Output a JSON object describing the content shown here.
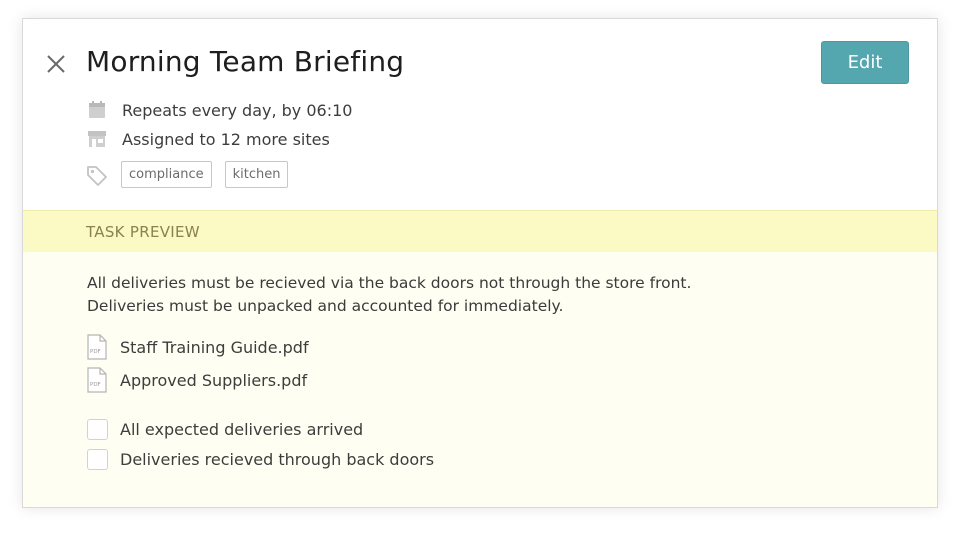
{
  "header": {
    "title": "Morning Team Briefing",
    "edit_label": "Edit",
    "close_icon": "close-icon"
  },
  "meta": {
    "schedule": "Repeats every day, by 06:10",
    "schedule_icon": "calendar-icon",
    "assignment": "Assigned to 12 more sites",
    "assignment_icon": "store-icon",
    "tags_icon": "tag-icon",
    "tags": [
      "compliance",
      "kitchen"
    ]
  },
  "preview": {
    "label": "TASK PREVIEW",
    "description_lines": [
      "All deliveries must be recieved via the back doors not through the store front.",
      "Deliveries must be unpacked and accounted for immediately."
    ],
    "files": [
      {
        "name": "Staff Training Guide.pdf",
        "icon": "pdf-file-icon"
      },
      {
        "name": "Approved Suppliers.pdf",
        "icon": "pdf-file-icon"
      }
    ],
    "checklist": [
      {
        "label": "All expected deliveries arrived",
        "checked": false
      },
      {
        "label": "Deliveries recieved through back doors",
        "checked": false
      }
    ]
  },
  "colors": {
    "accent": "#54a7ae",
    "preview_bar": "#fbf9c4",
    "preview_body": "#fefef2"
  }
}
